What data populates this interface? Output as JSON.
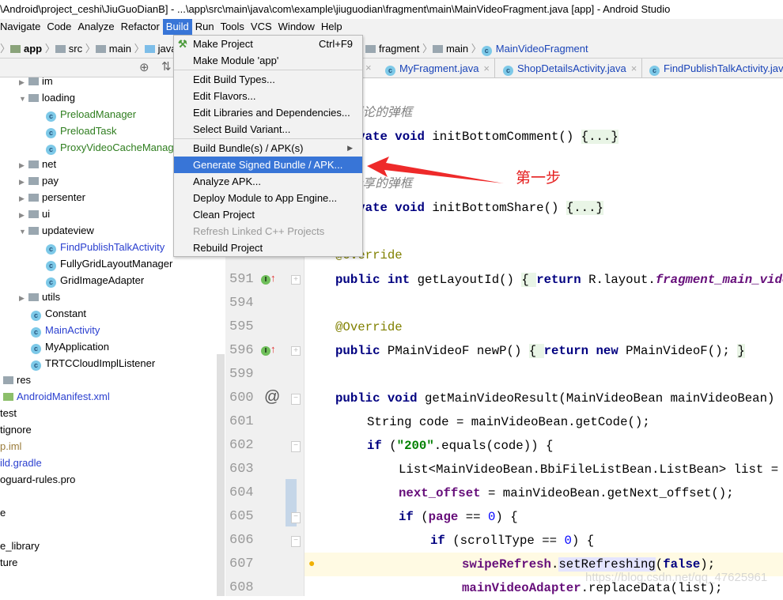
{
  "window": {
    "title": "\\Android\\project_ceshi\\JiuGuoDianB] - ...\\app\\src\\main\\java\\com\\example\\jiuguodian\\fragment\\main\\MainVideoFragment.java [app] - Android Studio"
  },
  "menubar": [
    "Navigate",
    "Code",
    "Analyze",
    "Refactor",
    "Build",
    "Run",
    "Tools",
    "VCS",
    "Window",
    "Help"
  ],
  "breadcrumb": {
    "left": [
      "app",
      "src",
      "main",
      "java"
    ],
    "right": [
      "fragment",
      "main",
      "MainVideoFragment"
    ]
  },
  "tabs": [
    "MyFragment.java",
    "ShopDetailsActivity.java",
    "FindPublishTalkActivity.java"
  ],
  "build_menu": [
    {
      "label": "Make Project",
      "shortcut": "Ctrl+F9",
      "icon": "hammer-icon"
    },
    {
      "label": "Make Module 'app'"
    },
    {
      "sep": true
    },
    {
      "label": "Edit Build Types..."
    },
    {
      "label": "Edit Flavors..."
    },
    {
      "label": "Edit Libraries and Dependencies..."
    },
    {
      "label": "Select Build Variant..."
    },
    {
      "sep": true
    },
    {
      "label": "Build Bundle(s) / APK(s)",
      "submenu": true
    },
    {
      "label": "Generate Signed Bundle / APK...",
      "selected": true
    },
    {
      "label": "Analyze APK..."
    },
    {
      "label": "Deploy Module to App Engine..."
    },
    {
      "label": "Clean Project"
    },
    {
      "label": "Refresh Linked C++ Projects",
      "disabled": true
    },
    {
      "label": "Rebuild Project"
    }
  ],
  "tree": [
    {
      "label": "im",
      "type": "folder",
      "indent": 2,
      "arrow": "right"
    },
    {
      "label": "loading",
      "type": "folder",
      "indent": 2,
      "arrow": "down"
    },
    {
      "label": "PreloadManager",
      "type": "class",
      "indent": 3,
      "color": "#2e7d1e"
    },
    {
      "label": "PreloadTask",
      "type": "class",
      "indent": 3,
      "color": "#2e7d1e"
    },
    {
      "label": "ProxyVideoCacheManager",
      "type": "class",
      "indent": 3,
      "color": "#2e7d1e"
    },
    {
      "label": "net",
      "type": "folder",
      "indent": 2,
      "arrow": "right"
    },
    {
      "label": "pay",
      "type": "folder",
      "indent": 2,
      "arrow": "right"
    },
    {
      "label": "persenter",
      "type": "folder",
      "indent": 2,
      "arrow": "right"
    },
    {
      "label": "ui",
      "type": "folder",
      "indent": 2,
      "arrow": "right"
    },
    {
      "label": "updateview",
      "type": "folder",
      "indent": 2,
      "arrow": "down"
    },
    {
      "label": "FindPublishTalkActivity",
      "type": "class",
      "indent": 3,
      "color": "#2a3fcf"
    },
    {
      "label": "FullyGridLayoutManager",
      "type": "class",
      "indent": 3
    },
    {
      "label": "GridImageAdapter",
      "type": "class",
      "indent": 3
    },
    {
      "label": "utils",
      "type": "folder",
      "indent": 2,
      "arrow": "right"
    },
    {
      "label": "Constant",
      "type": "class",
      "indent": 2
    },
    {
      "label": "MainActivity",
      "type": "class",
      "indent": 2,
      "color": "#2a3fcf"
    },
    {
      "label": "MyApplication",
      "type": "class",
      "indent": 2
    },
    {
      "label": "TRTCCloudImplListener",
      "type": "class",
      "indent": 2
    },
    {
      "label": "res",
      "type": "res",
      "indent": 0
    },
    {
      "label": "AndroidManifest.xml",
      "type": "manifest",
      "indent": 0,
      "color": "#2a3fcf"
    },
    {
      "label": "test",
      "type": "plain",
      "indent": -1
    },
    {
      "label": "tignore",
      "type": "plain",
      "indent": -1
    },
    {
      "label": "p.iml",
      "type": "plain",
      "indent": -1,
      "color": "#9a7b3a"
    },
    {
      "label": "ild.gradle",
      "type": "plain",
      "indent": -1,
      "color": "#2a3fcf"
    },
    {
      "label": "oguard-rules.pro",
      "type": "plain",
      "indent": -1
    },
    {
      "label": "",
      "type": "plain",
      "indent": -1
    },
    {
      "label": "e",
      "type": "plain",
      "indent": -1
    },
    {
      "label": "",
      "type": "plain",
      "indent": -1
    },
    {
      "label": "e_library",
      "type": "plain",
      "indent": -1
    },
    {
      "label": "ture",
      "type": "plain",
      "indent": -1
    }
  ],
  "code": [
    {
      "n": "",
      "i": 0,
      "t": [
        [
          "cm",
          "//评论的弹框"
        ]
      ]
    },
    {
      "n": "",
      "i": 0,
      "t": [
        [
          "kw",
          "private void "
        ],
        [
          "",
          "initBottomComment() "
        ],
        [
          "fold",
          "{...}"
        ]
      ]
    },
    {
      "n": "",
      "i": 0,
      "t": []
    },
    {
      "n": "",
      "i": 0,
      "t": [
        [
          "cm",
          "//分享的弹框"
        ]
      ]
    },
    {
      "n": "",
      "i": 0,
      "t": [
        [
          "kw",
          "private void "
        ],
        [
          "",
          "initBottomShare() "
        ],
        [
          "fold",
          "{...}"
        ]
      ]
    },
    {
      "n": "",
      "i": 0,
      "t": []
    },
    {
      "n": "",
      "i": 0,
      "t": [
        [
          "an",
          "@Override"
        ]
      ]
    },
    {
      "n": "591",
      "i": 0,
      "g": "implements-icon",
      "t": [
        [
          "kw",
          "public int "
        ],
        [
          "",
          "getLayoutId() "
        ],
        [
          "fold",
          "{ "
        ],
        [
          "kw",
          "return "
        ],
        [
          "",
          "R.layout."
        ],
        [
          "it",
          "fragment_main_video"
        ]
      ]
    },
    {
      "n": "594",
      "i": 0,
      "t": []
    },
    {
      "n": "595",
      "i": 0,
      "t": [
        [
          "an",
          "@Override"
        ]
      ]
    },
    {
      "n": "596",
      "i": 0,
      "g": "implements-icon",
      "t": [
        [
          "kw",
          "public "
        ],
        [
          "",
          "PMainVideoF newP() "
        ],
        [
          "fold",
          "{ "
        ],
        [
          "kw",
          "return new "
        ],
        [
          "",
          "PMainVideoF(); "
        ],
        [
          "fold",
          "}"
        ]
      ]
    },
    {
      "n": "599",
      "i": 0,
      "t": []
    },
    {
      "n": "600",
      "i": 0,
      "g": "at-icon",
      "t": [
        [
          "kw",
          "public void "
        ],
        [
          "",
          "getMainVideoResult(MainVideoBean mainVideoBean) {"
        ]
      ]
    },
    {
      "n": "601",
      "i": 1,
      "t": [
        [
          "",
          "String code = mainVideoBean.getCode();"
        ]
      ]
    },
    {
      "n": "602",
      "i": 1,
      "t": [
        [
          "kw",
          "if "
        ],
        [
          "",
          "("
        ],
        [
          "str",
          "\"200\""
        ],
        [
          "",
          ".equals(code)) {"
        ]
      ]
    },
    {
      "n": "603",
      "i": 2,
      "t": [
        [
          "",
          "List<MainVideoBean.BbiFileListBean.ListBean> list = "
        ]
      ]
    },
    {
      "n": "604",
      "i": 2,
      "t": [
        [
          "fld",
          "next_offset"
        ],
        [
          "",
          " = mainVideoBean.getNext_offset();"
        ]
      ]
    },
    {
      "n": "605",
      "i": 2,
      "t": [
        [
          "kw",
          "if "
        ],
        [
          "",
          "("
        ],
        [
          "fld",
          "page"
        ],
        [
          "",
          " == "
        ],
        [
          "num",
          "0"
        ],
        [
          "",
          ") {"
        ]
      ]
    },
    {
      "n": "606",
      "i": 3,
      "t": [
        [
          "kw",
          "if "
        ],
        [
          "",
          "(scrollType == "
        ],
        [
          "num",
          "0"
        ],
        [
          "",
          ") {"
        ]
      ]
    },
    {
      "n": "607",
      "i": 4,
      "g": "bulb-icon",
      "t": [
        [
          "fld",
          "swipeRefresh"
        ],
        [
          "",
          "."
        ],
        [
          "hl",
          "setRefreshing"
        ],
        [
          "",
          "("
        ],
        [
          "kw",
          "false"
        ],
        [
          "",
          ");"
        ]
      ]
    },
    {
      "n": "608",
      "i": 4,
      "t": [
        [
          "fld",
          "mainVideoAdapter"
        ],
        [
          "",
          ".replaceData(list);"
        ]
      ]
    }
  ],
  "annotation": {
    "text": "第一步",
    "color": "#e52020"
  },
  "watermark": "https://blog.csdn.net/qq_47625961",
  "colors": {
    "accent": "#3875d7",
    "keyword": "#000080",
    "current_line": "#fffae3"
  }
}
